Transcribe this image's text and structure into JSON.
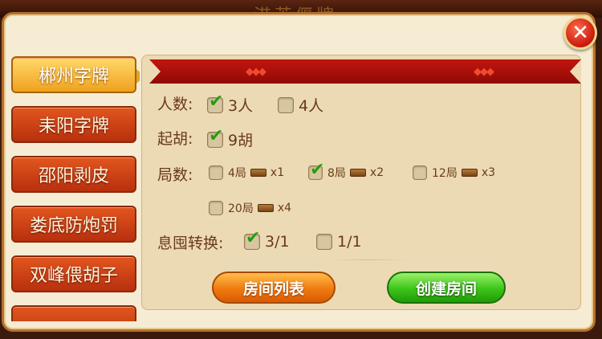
{
  "header": {
    "title_partial": "港英偃牌"
  },
  "close_label": "✕",
  "tabs": [
    {
      "label": "郴州字牌",
      "active": true
    },
    {
      "label": "耒阳字牌",
      "active": false
    },
    {
      "label": "邵阳剥皮",
      "active": false
    },
    {
      "label": "娄底防炮罚",
      "active": false
    },
    {
      "label": "双峰偎胡子",
      "active": false
    }
  ],
  "settings": {
    "players": {
      "label": "人数:",
      "options": [
        {
          "text": "3人",
          "checked": true
        },
        {
          "text": "4人",
          "checked": false
        }
      ]
    },
    "start_hu": {
      "label": "起胡:",
      "options": [
        {
          "text": "9胡",
          "checked": true
        }
      ]
    },
    "rounds": {
      "label": "局数:",
      "options": [
        {
          "text": "4局",
          "mult": "x1",
          "checked": false
        },
        {
          "text": "8局",
          "mult": "x2",
          "checked": true
        },
        {
          "text": "12局",
          "mult": "x3",
          "checked": false
        },
        {
          "text": "20局",
          "mult": "x4",
          "checked": false
        }
      ]
    },
    "conversion": {
      "label": "息囤转换:",
      "options": [
        {
          "text": "3/1",
          "checked": true
        },
        {
          "text": "1/1",
          "checked": false
        }
      ]
    }
  },
  "buttons": {
    "room_list": "房间列表",
    "create_room": "创建房间"
  },
  "colors": {
    "accent_red": "#c4150e",
    "tab_orange": "#d8451a",
    "tab_active": "#f0a21e",
    "check_green": "#2a9a12"
  }
}
